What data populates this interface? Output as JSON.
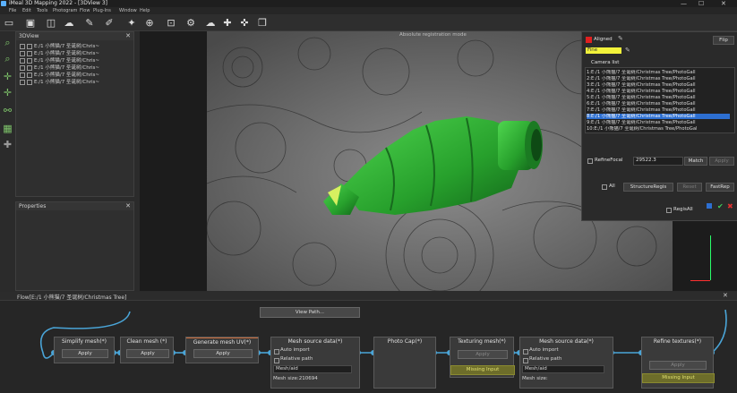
{
  "window": {
    "title": "iMeal 3D Mapping 2022 - [3DView 3]",
    "minimize": "—",
    "maximize": "☐",
    "close": "✕"
  },
  "menu": [
    "File",
    "Edit",
    "Tools",
    "Photogram",
    "Flow",
    "Plug-Ins",
    "Window",
    "Help"
  ],
  "toolbar_icons": [
    "new-icon",
    "open-icon",
    "save-icon",
    "import-icon",
    "cloud-icon",
    "brush-icon",
    "edit-icon",
    "pin-icon",
    "target-icon",
    "camera-icon",
    "mesh-icon",
    "cloud-upload-icon",
    "puzzle-icon",
    "puzzle-plus-icon",
    "layers-icon"
  ],
  "left_tools": [
    "zoom-icon",
    "zoom-region-icon",
    "move-icon",
    "axis-icon",
    "nodes-icon",
    "grid-icon",
    "hand-icon"
  ],
  "tree_panel": {
    "title": "3DView",
    "rows": [
      "E:/1 小熊猫/7 圣诞树/Chris~",
      "E:/1 小熊猫/7 圣诞树/Chris~",
      "E:/1 小熊猫/7 圣诞树/Chris~",
      "E:/1 小熊猫/7 圣诞树/Chris~",
      "E:/1 小熊猫/7 圣诞树/Chris~",
      "E:/1 小熊猫/7 圣诞树/Chris~"
    ]
  },
  "properties_panel": {
    "title": "Properties"
  },
  "viewport": {
    "hint": "Absolute registration mode"
  },
  "camera_panel": {
    "aligned_label": "Aligned",
    "fine_label": "Fine",
    "list_title": "Camera list",
    "cameras": [
      "1:E:/1 小熊猫/7 圣诞树/Christmas Tree/PhotoGall",
      "2:E:/1 小熊猫/7 圣诞树/Christmas Tree/PhotoGall",
      "3:E:/1 小熊猫/7 圣诞树/Christmas Tree/PhotoGall",
      "4:E:/1 小熊猫/7 圣诞树/Christmas Tree/PhotoGall",
      "5:E:/1 小熊猫/7 圣诞树/Christmas Tree/PhotoGall",
      "6:E:/1 小熊猫/7 圣诞树/Christmas Tree/PhotoGall",
      "7:E:/1 小熊猫/7 圣诞树/Christmas Tree/PhotoGall",
      "8:E:/1 小熊猫/7 圣诞树/Christmas Tree/PhotoGall",
      "9:E:/1 小熊猫/7 圣诞树/Christmas Tree/PhotoGall",
      "10:E:/1 小熊猫/7 圣诞树/Christmas Tree/PhotoGal"
    ],
    "selected_index": 7,
    "refine_focal_label": "RefineFocal",
    "focal_value": "29522.3",
    "match_label": "Match",
    "apply_label": "Apply",
    "all_label": "All",
    "structure_label": "StructureRegis",
    "reset_label": "Reset",
    "fast_label": "FastRep",
    "regis_all_label": "RegisAll",
    "top_btn": "Flip"
  },
  "flow": {
    "header": "Flow[E:/1 小熊猫/7 圣诞树/Christmas Tree]",
    "view_path_label": "View Path...",
    "nodes": [
      {
        "title": "Simplify mesh(*)",
        "button": "Apply"
      },
      {
        "title": "Clean mesh (*)",
        "button": "Apply"
      },
      {
        "title": "Generate mesh UV(*)",
        "button": "Apply"
      },
      {
        "title": "Mesh source data(*)",
        "auto_import": "Auto import",
        "relative_path": "Relative path",
        "path": "Mesh/aid",
        "size": "Mesh size:210694"
      },
      {
        "title": "Photo Cap(*)"
      },
      {
        "title": "Texturing mesh(*)",
        "button": "Apply",
        "missing": "Missing Input"
      },
      {
        "title": "Mesh source data(*)",
        "auto_import": "Auto import",
        "relative_path": "Relative path",
        "path": "Mesh/aid",
        "size": "Mesh size:"
      },
      {
        "title": "Refine textures(*)",
        "button": "Apply",
        "missing": "Missing Input"
      }
    ]
  },
  "colors": {
    "accent": "#2d6fd1",
    "tree_green": "#2fa83a",
    "missing_bg": "#6d6d2a",
    "aligned_red": "#e02020",
    "fine_yellow": "#f2f23a"
  }
}
